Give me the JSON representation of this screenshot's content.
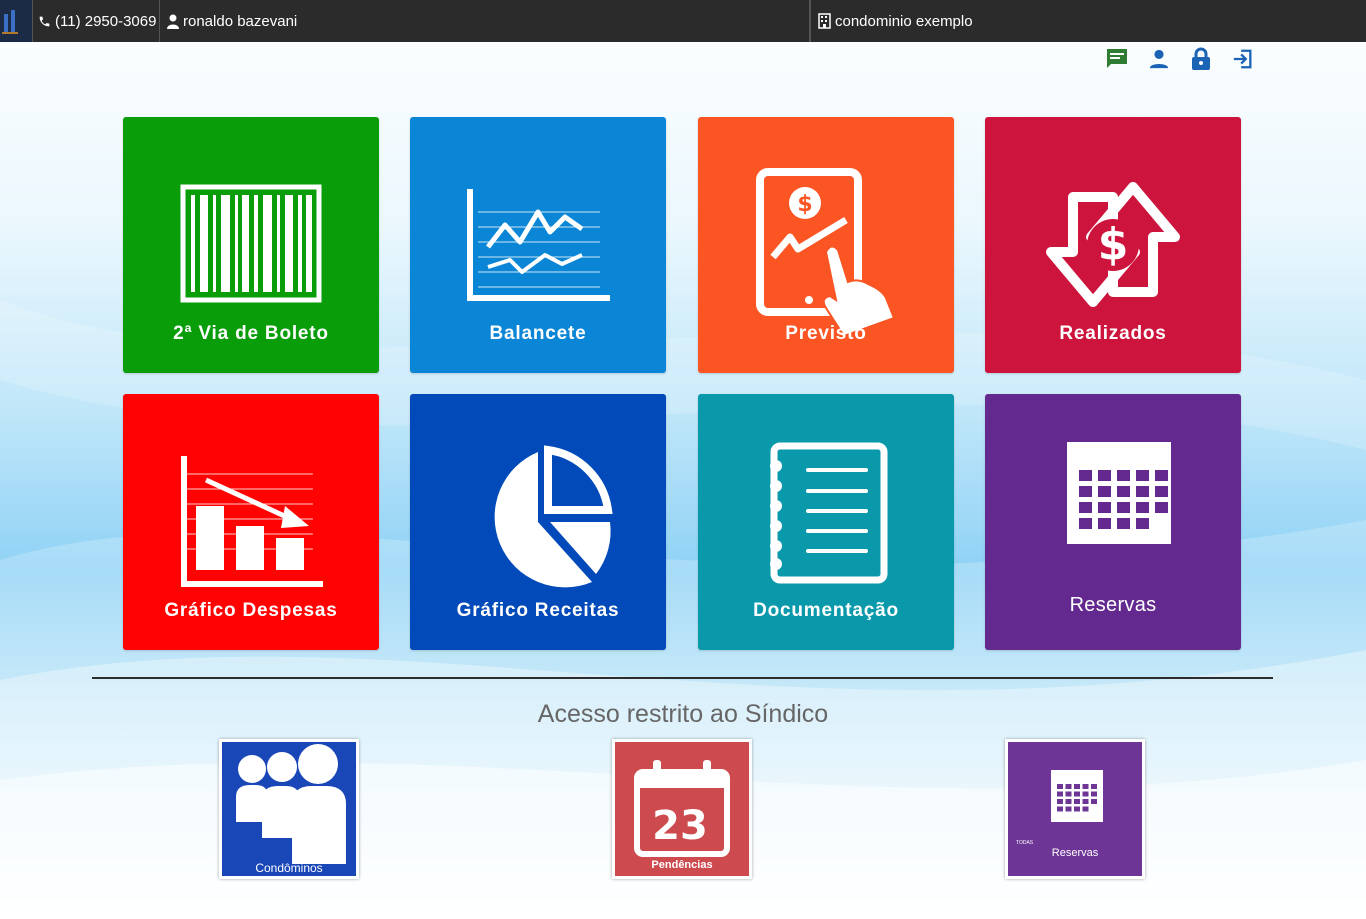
{
  "topbar": {
    "phone": "(11) 2950-3069",
    "user": "ronaldo bazevani",
    "condo": "condominio exemplo"
  },
  "actions": [
    {
      "name": "messages-icon",
      "color": "#2e7d32"
    },
    {
      "name": "user-icon",
      "color": "#1565c0"
    },
    {
      "name": "lock-icon",
      "color": "#1565c0"
    },
    {
      "name": "logout-icon",
      "color": "#1565c0"
    }
  ],
  "tiles": [
    {
      "label": "2ª Via de Boleto",
      "color": "#0a9d0a",
      "icon": "barcode-icon"
    },
    {
      "label": "Balancete",
      "color": "#0b86d6",
      "icon": "line-chart-icon"
    },
    {
      "label": "Previsto",
      "color": "#fa5523",
      "icon": "tablet-money-icon"
    },
    {
      "label": "Realizados",
      "color": "#cc143c",
      "icon": "money-arrows-icon"
    },
    {
      "label": "Gráfico Despesas",
      "color": "#ff0202",
      "icon": "bar-chart-down-icon"
    },
    {
      "label": "Gráfico Receitas",
      "color": "#0249b9",
      "icon": "pie-chart-icon"
    },
    {
      "label": "Documentação",
      "color": "#0a99ab",
      "icon": "notebook-icon"
    },
    {
      "label": "Reservas",
      "color": "#63298f",
      "icon": "calendar-icon"
    }
  ],
  "restricted": {
    "title": "Acesso restrito ao Síndico",
    "items": [
      {
        "label": "Condôminos",
        "color": "#1a47b8",
        "icon": "people-icon"
      },
      {
        "label": "Pendências",
        "color": "#cd4a4f",
        "icon": "calendar-day-icon",
        "day": "23"
      },
      {
        "label": "Reservas",
        "color": "#6d3596",
        "icon": "calendar-icon",
        "tag": "TODAS"
      }
    ]
  }
}
